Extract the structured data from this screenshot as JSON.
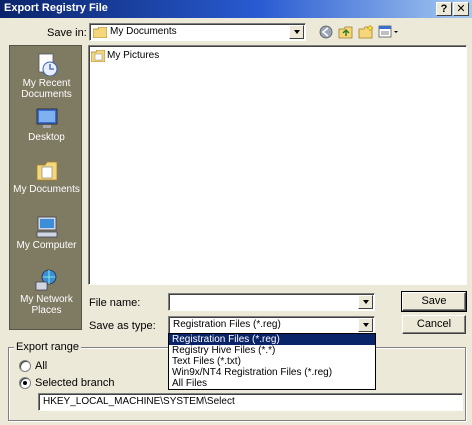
{
  "window": {
    "title": "Export Registry File",
    "help_button": "?",
    "close_button": "X"
  },
  "save_in": {
    "label": "Save in:",
    "value": "My Documents"
  },
  "places": [
    {
      "label": "My Recent Documents",
      "icon": "recent-documents-icon"
    },
    {
      "label": "Desktop",
      "icon": "desktop-icon"
    },
    {
      "label": "My Documents",
      "icon": "my-documents-icon"
    },
    {
      "label": "My Computer",
      "icon": "my-computer-icon"
    },
    {
      "label": "My Network Places",
      "icon": "network-places-icon"
    }
  ],
  "file_list": [
    {
      "name": "My Pictures",
      "icon": "folder-icon"
    }
  ],
  "file_name": {
    "label": "File name:",
    "value": ""
  },
  "save_as_type": {
    "label": "Save as type:",
    "value": "Registration Files (*.reg)",
    "options": [
      "Registration Files (*.reg)",
      "Registry Hive Files (*.*)",
      "Text Files (*.txt)",
      "Win9x/NT4 Registration Files (*.reg)",
      "All Files"
    ]
  },
  "buttons": {
    "save": "Save",
    "cancel": "Cancel"
  },
  "export_range": {
    "label": "Export range",
    "all_label": "All",
    "selected_label": "Selected branch",
    "selected": "selected_branch",
    "branch_value": "HKEY_LOCAL_MACHINE\\SYSTEM\\Select"
  }
}
